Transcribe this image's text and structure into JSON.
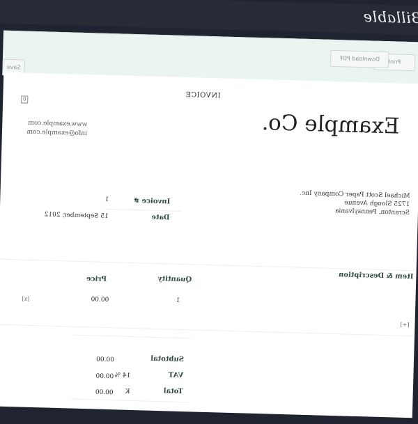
{
  "app": {
    "brand": "Billable"
  },
  "toolbar": {
    "print_label": "Print",
    "download_pdf_label": "Download PDF",
    "save_label": "Save"
  },
  "invoice": {
    "heading": "INVOICE",
    "company_name": "Example Co.",
    "company_website": "www.example.com",
    "company_email": "info@example.com",
    "client_lines": [
      "Michael Scott Paper Company Inc.",
      "1725 Slough Avenue",
      "Scranton, Pennsylvania"
    ],
    "invoice_number_label": "Invoice #",
    "invoice_number": "1",
    "date_label": "Date",
    "date_value": "15 September, 2012",
    "small_box_glyph": "0"
  },
  "items": {
    "headers": {
      "description": "Item & Description",
      "quantity": "Quantity",
      "price": "Price"
    },
    "rows": [
      {
        "quantity": "1",
        "price": "00.00",
        "remove_label": "[x]"
      }
    ],
    "add_label": "[+]"
  },
  "totals": {
    "subtotal_label": "Subtotal",
    "subtotal_value": "00.00",
    "vat_label": "VAT",
    "vat_rate": "14 %",
    "vat_value": "00.00",
    "total_label": "Total",
    "currency": "K",
    "total_value": "00.00"
  }
}
